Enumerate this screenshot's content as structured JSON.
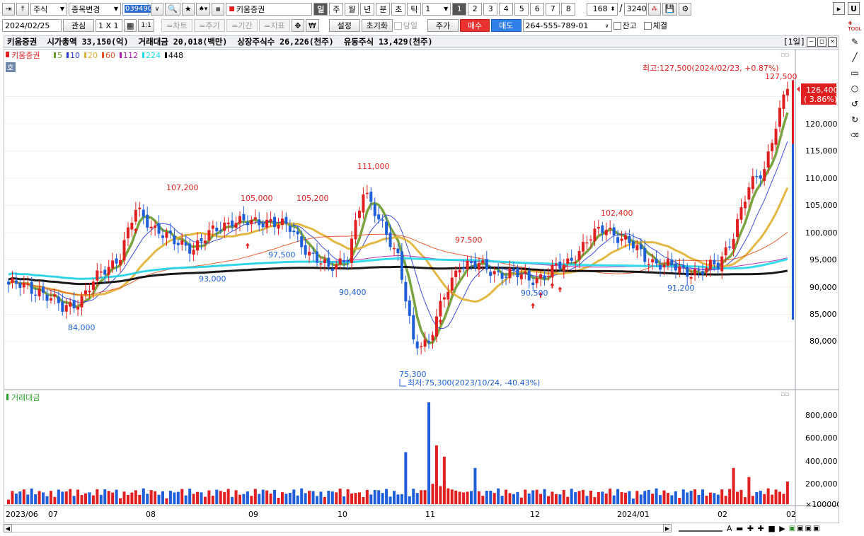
{
  "toolbar1": {
    "market": "주식",
    "change_stock": "종목변경",
    "code": "039490",
    "stock_name": "키움증권",
    "periods": [
      "일",
      "주",
      "월",
      "년",
      "분",
      "초",
      "틱"
    ],
    "period_value": "1",
    "nums": [
      "1",
      "2",
      "3",
      "4",
      "5",
      "6",
      "7",
      "8"
    ],
    "count": "168",
    "total": "3240",
    "slash": "/"
  },
  "toolbar2": {
    "date": "2024/02/25",
    "watch": "관심",
    "layout": "1 X 1",
    "one_one": "1:1",
    "chart": "=차트",
    "cycle": "=주기",
    "period": "=기간",
    "indicator": "=지표",
    "settings": "설정",
    "reset": "초기화",
    "today": "당일",
    "price": "주가",
    "buy": "매수",
    "sell": "매도",
    "account": "264-555-789-01",
    "balance": "잔고",
    "executed": "체결"
  },
  "infobar": {
    "name": "키움증권",
    "market_cap": "시가총액 33,150(억)",
    "trade_value": "거래대금 20,018(백만)",
    "listed_shares": "상장주식수 26,226(천주)",
    "float_shares": "유동주식 13,429(천주)",
    "window_label": "[1일]"
  },
  "legend": {
    "stock": "키움증권",
    "ma": [
      {
        "label": "5",
        "color": "#6a9a2a"
      },
      {
        "label": "10",
        "color": "#2b3bd6"
      },
      {
        "label": "20",
        "color": "#e0b030"
      },
      {
        "label": "60",
        "color": "#e05020"
      },
      {
        "label": "112",
        "color": "#b020b0"
      },
      {
        "label": "224",
        "color": "#20d8e8"
      },
      {
        "label": "448",
        "color": "#000000"
      }
    ],
    "quote_tag": "호"
  },
  "price_axis": [
    "120,000",
    "115,000",
    "110,000",
    "105,000",
    "100,000",
    "95,000",
    "90,000",
    "85,000",
    "80,000"
  ],
  "volume_axis": [
    "800,000",
    "600,000",
    "400,000",
    "200,000",
    "×100000"
  ],
  "time_axis": [
    "2023/06",
    "07",
    "08",
    "09",
    "10",
    "11",
    "12",
    "2024/01",
    "02",
    "02"
  ],
  "current": {
    "price": "126,400",
    "change": "( 3.86%)"
  },
  "annotations": {
    "high": "최고:127,500(2024/02/23, +0.87%)",
    "low": "최저:75,300(2023/10/24, -40.43%)",
    "labels": [
      "127,500",
      "107,200",
      "105,000",
      "105,200",
      "111,000",
      "97,500",
      "102,400",
      "84,000",
      "93,000",
      "97,500",
      "90,400",
      "75,300",
      "90,500",
      "91,200"
    ]
  },
  "volume_title": "거래대금",
  "colors": {
    "up": "#e02020",
    "down": "#1e5fd8"
  },
  "chart_data": {
    "type": "candlestick",
    "title": "키움증권",
    "period": "daily",
    "x_start": "2023/06",
    "x_end": "2024/02/26",
    "ylim": [
      76000,
      128000
    ],
    "labeled_points": [
      {
        "date": "2023/07",
        "value": 84000
      },
      {
        "date": "2023/08",
        "value": 107200
      },
      {
        "date": "2023/08",
        "value": 93000
      },
      {
        "date": "2023/09",
        "value": 105000
      },
      {
        "date": "2023/09",
        "value": 97500
      },
      {
        "date": "2023/09",
        "value": 105200
      },
      {
        "date": "2023/10",
        "value": 90400
      },
      {
        "date": "2023/10",
        "value": 111000
      },
      {
        "date": "2023/10/24",
        "value": 75300
      },
      {
        "date": "2023/11",
        "value": 97500
      },
      {
        "date": "2023/12",
        "value": 90500
      },
      {
        "date": "2023/12",
        "value": 102400
      },
      {
        "date": "2024/01",
        "value": 91200
      },
      {
        "date": "2024/02/23",
        "value": 127500
      }
    ],
    "close_path": [
      [
        0,
        90500
      ],
      [
        8,
        89500
      ],
      [
        14,
        86000
      ],
      [
        19,
        88000
      ],
      [
        24,
        92500
      ],
      [
        29,
        96000
      ],
      [
        33,
        104000
      ],
      [
        38,
        101000
      ],
      [
        43,
        98000
      ],
      [
        48,
        97500
      ],
      [
        53,
        100000
      ],
      [
        58,
        102500
      ],
      [
        63,
        101500
      ],
      [
        68,
        102500
      ],
      [
        73,
        100500
      ],
      [
        78,
        96500
      ],
      [
        83,
        93000
      ],
      [
        88,
        96000
      ],
      [
        92,
        107000
      ],
      [
        97,
        102000
      ],
      [
        101,
        95000
      ],
      [
        105,
        80000
      ],
      [
        109,
        80000
      ],
      [
        113,
        88000
      ],
      [
        117,
        94500
      ],
      [
        121,
        94000
      ],
      [
        125,
        93000
      ],
      [
        130,
        92500
      ],
      [
        135,
        91500
      ],
      [
        140,
        92500
      ],
      [
        145,
        94500
      ],
      [
        150,
        98500
      ],
      [
        155,
        101000
      ],
      [
        160,
        98500
      ],
      [
        165,
        95500
      ],
      [
        170,
        94000
      ],
      [
        175,
        93000
      ],
      [
        180,
        93000
      ],
      [
        184,
        94000
      ],
      [
        188,
        100000
      ],
      [
        192,
        108000
      ],
      [
        196,
        112000
      ],
      [
        199,
        120000
      ],
      [
        202,
        126400
      ]
    ],
    "moving_averages": [
      {
        "name": "5",
        "color": "#6a9a2a"
      },
      {
        "name": "10",
        "color": "#2b3bd6"
      },
      {
        "name": "20",
        "color": "#e0b030"
      },
      {
        "name": "60",
        "color": "#e05020"
      },
      {
        "name": "112",
        "color": "#b020b0"
      },
      {
        "name": "224",
        "color": "#20d8e8"
      },
      {
        "name": "448",
        "color": "#000000"
      }
    ],
    "volume_series": {
      "name": "거래대금",
      "ylim": [
        0,
        900000
      ],
      "peaks": [
        {
          "date": "2023/10",
          "value": 460000
        },
        {
          "date": "2023/10/24",
          "value": 900000
        },
        {
          "date": "2023/10",
          "value": 520000
        },
        {
          "date": "2023/11",
          "value": 320000
        },
        {
          "date": "2024/02",
          "value": 320000
        },
        {
          "date": "2024/02/26",
          "value": 200000
        }
      ]
    }
  }
}
